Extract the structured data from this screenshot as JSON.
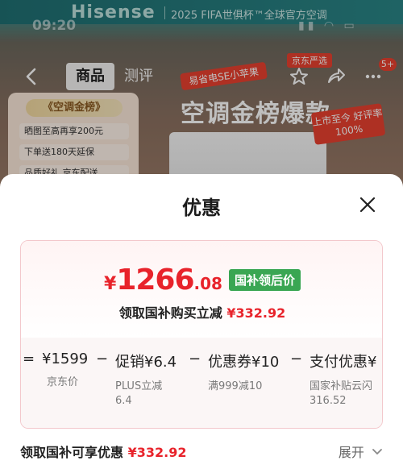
{
  "status_bar": {
    "time": "09:20",
    "signal_icons": "signal-wifi-battery"
  },
  "banner": {
    "brand": "Hisense",
    "tagline": "2025 FIFA世俱杯™全球官方空调"
  },
  "nav": {
    "tabs": [
      {
        "label": "商品"
      },
      {
        "label": "测评"
      }
    ],
    "cart_count": "5+"
  },
  "hero": {
    "ribbon": "易省电SE小苹果",
    "jd_tag": "京东严选",
    "title": "空调金榜爆款",
    "rate_badge": "上市至今 好评率100%",
    "left_panel": {
      "title": "《空调金榜》",
      "rows": [
        "晒图至高再享200元",
        "下单送180天延保",
        "品质好礼 京东配送"
      ]
    }
  },
  "sheet": {
    "title": "优惠",
    "price": {
      "currency": "¥",
      "integer": "1266",
      "decimal": ".08",
      "tag": "国补领后价"
    },
    "subsidy_line": {
      "label": "领取国补购买立减",
      "amount": "¥332.92"
    },
    "breakdown": [
      {
        "op": "=",
        "main": "¥1599",
        "sub": "京东价"
      },
      {
        "op": "−",
        "main": "促销¥6.4",
        "sub": "PLUS立减\n6.4"
      },
      {
        "op": "−",
        "main": "优惠券¥10",
        "sub": "满999减10"
      },
      {
        "op": "−",
        "main": "支付优惠¥",
        "sub": "国家补贴云闪\n316.52"
      }
    ],
    "footer": {
      "label": "领取国补可享优惠",
      "amount": "¥332.92",
      "expand": "展开"
    }
  },
  "colors": {
    "accent_red": "#e8232b",
    "tag_green": "#3aa653",
    "card_border": "#f3c8cc"
  }
}
